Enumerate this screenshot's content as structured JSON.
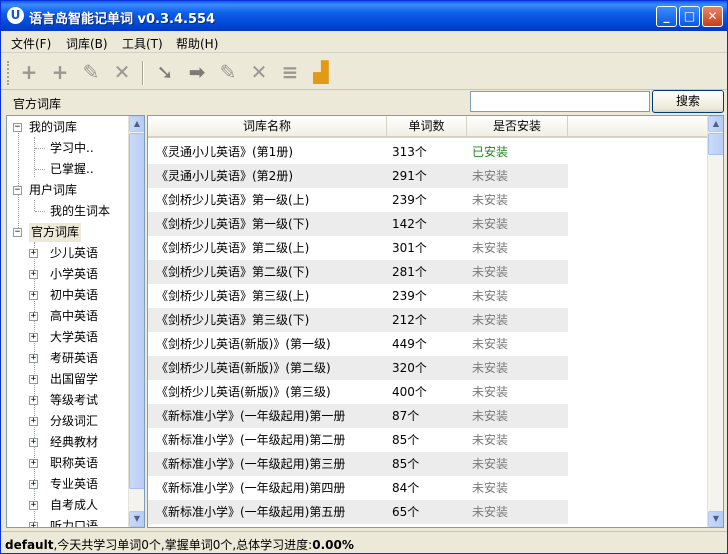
{
  "window": {
    "title": "语言岛智能记单词  v0.3.4.554",
    "app_icon_glyph": "U",
    "buttons": {
      "minimize": "_",
      "maximize": "□",
      "close": "✕"
    }
  },
  "menu": [
    "文件(F)",
    "词库(B)",
    "工具(T)",
    "帮助(H)"
  ],
  "toolbar": {
    "icons": [
      {
        "name": "add-icon",
        "glyph": "+"
      },
      {
        "name": "add-sub-icon",
        "glyph": "+"
      },
      {
        "name": "edit-icon",
        "glyph": "✎"
      },
      {
        "name": "delete-icon",
        "glyph": "✕"
      },
      {
        "name": "arrow-down-icon",
        "glyph": "➘"
      },
      {
        "name": "arrow-right-icon",
        "glyph": "➡"
      },
      {
        "name": "edit-word-icon",
        "glyph": "✎"
      },
      {
        "name": "delete-word-icon",
        "glyph": "✕"
      },
      {
        "name": "list-icon",
        "glyph": "≡"
      },
      {
        "name": "bar-chart-icon",
        "glyph": "▟"
      }
    ]
  },
  "pathbar": {
    "label": "官方词库",
    "search_value": "",
    "search_button": "搜索"
  },
  "tree": [
    {
      "label": "我的词库",
      "level": 0,
      "toggle": "−"
    },
    {
      "label": "学习中..",
      "level": 1
    },
    {
      "label": "已掌握..",
      "level": 1
    },
    {
      "label": "用户词库",
      "level": 0,
      "toggle": "−"
    },
    {
      "label": "我的生词本",
      "level": 1
    },
    {
      "label": "官方词库",
      "level": 0,
      "toggle": "−",
      "selected": true
    },
    {
      "label": "少儿英语",
      "level": 1,
      "toggle": "+"
    },
    {
      "label": "小学英语",
      "level": 1,
      "toggle": "+"
    },
    {
      "label": "初中英语",
      "level": 1,
      "toggle": "+"
    },
    {
      "label": "高中英语",
      "level": 1,
      "toggle": "+"
    },
    {
      "label": "大学英语",
      "level": 1,
      "toggle": "+"
    },
    {
      "label": "考研英语",
      "level": 1,
      "toggle": "+"
    },
    {
      "label": "出国留学",
      "level": 1,
      "toggle": "+"
    },
    {
      "label": "等级考试",
      "level": 1,
      "toggle": "+"
    },
    {
      "label": "分级词汇",
      "level": 1,
      "toggle": "+"
    },
    {
      "label": "经典教材",
      "level": 1,
      "toggle": "+"
    },
    {
      "label": "职称英语",
      "level": 1,
      "toggle": "+"
    },
    {
      "label": "专业英语",
      "level": 1,
      "toggle": "+"
    },
    {
      "label": "自考成人",
      "level": 1,
      "toggle": "+"
    },
    {
      "label": "听力口语",
      "level": 1,
      "toggle": "+"
    }
  ],
  "list": {
    "columns": [
      "词库名称",
      "单词数",
      "是否安装"
    ],
    "rows": [
      {
        "name": "《灵通小儿英语》(第1册)",
        "count": "313个",
        "status": "已安装",
        "installed": true
      },
      {
        "name": "《灵通小儿英语》(第2册)",
        "count": "291个",
        "status": "未安装"
      },
      {
        "name": "《剑桥少儿英语》第一级(上)",
        "count": "239个",
        "status": "未安装"
      },
      {
        "name": "《剑桥少儿英语》第一级(下)",
        "count": "142个",
        "status": "未安装"
      },
      {
        "name": "《剑桥少儿英语》第二级(上)",
        "count": "301个",
        "status": "未安装"
      },
      {
        "name": "《剑桥少儿英语》第二级(下)",
        "count": "281个",
        "status": "未安装"
      },
      {
        "name": "《剑桥少儿英语》第三级(上)",
        "count": "239个",
        "status": "未安装"
      },
      {
        "name": "《剑桥少儿英语》第三级(下)",
        "count": "212个",
        "status": "未安装"
      },
      {
        "name": "《剑桥少儿英语(新版)》(第一级)",
        "count": "449个",
        "status": "未安装"
      },
      {
        "name": "《剑桥少儿英语(新版)》(第二级)",
        "count": "320个",
        "status": "未安装"
      },
      {
        "name": "《剑桥少儿英语(新版)》(第三级)",
        "count": "400个",
        "status": "未安装"
      },
      {
        "name": "《新标准小学》(一年级起用)第一册",
        "count": "87个",
        "status": "未安装"
      },
      {
        "name": "《新标准小学》(一年级起用)第二册",
        "count": "85个",
        "status": "未安装"
      },
      {
        "name": "《新标准小学》(一年级起用)第三册",
        "count": "85个",
        "status": "未安装"
      },
      {
        "name": "《新标准小学》(一年级起用)第四册",
        "count": "84个",
        "status": "未安装"
      },
      {
        "name": "《新标准小学》(一年级起用)第五册",
        "count": "65个",
        "status": "未安装"
      }
    ]
  },
  "status": {
    "user": "default",
    "text": ",今天共学习单词0个,掌握单词0个,总体学习进度:",
    "progress": "0.00%"
  },
  "colors": {
    "installed": "#1f8a1f",
    "not_installed": "#7a7a7a",
    "titlebar": "#0045d6"
  }
}
